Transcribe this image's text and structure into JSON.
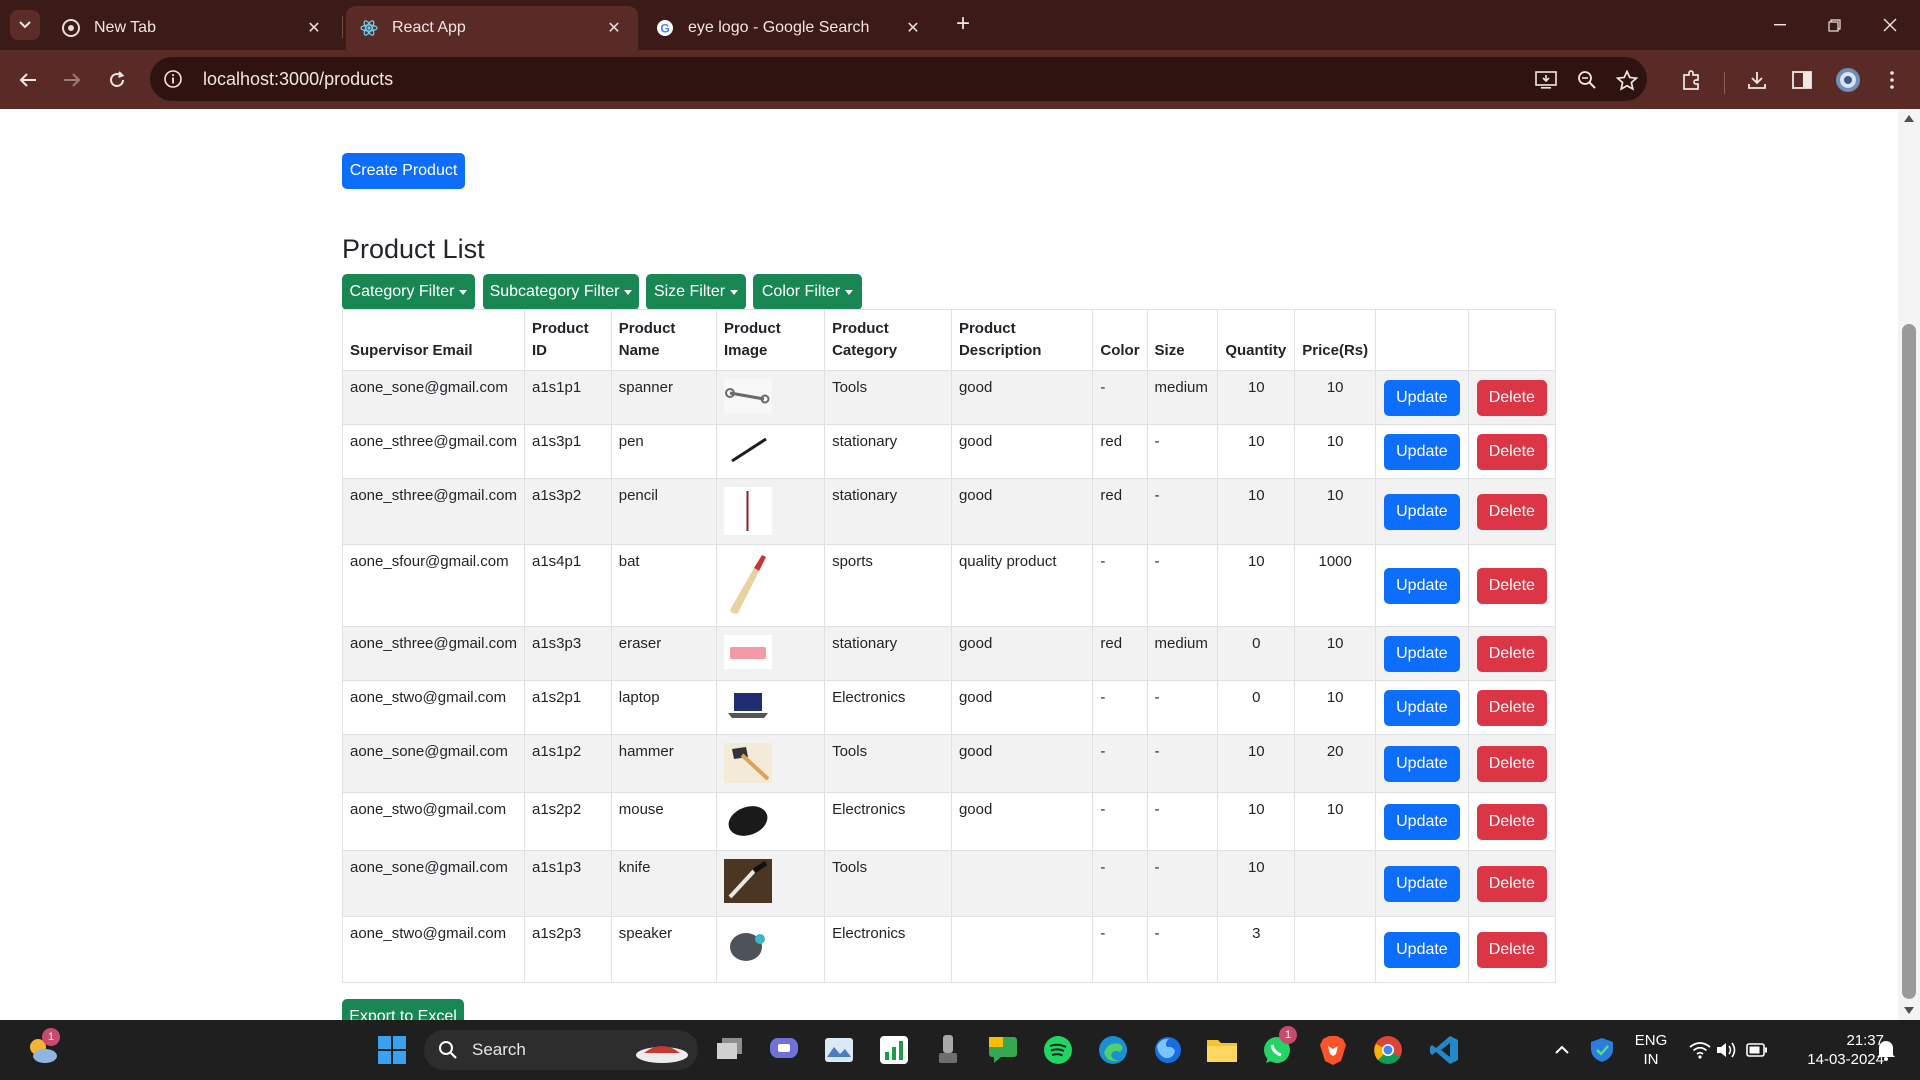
{
  "browser": {
    "tabs": [
      {
        "title": "New Tab",
        "icon": "chrome-icon"
      },
      {
        "title": "React App",
        "icon": "react-icon"
      },
      {
        "title": "eye logo - Google Search",
        "icon": "google-icon"
      }
    ],
    "url": "localhost:3000/products"
  },
  "page": {
    "create_button": "Create Product",
    "title": "Product List",
    "filters": {
      "category": "Category Filter",
      "subcategory": "Subcategory Filter",
      "size": "Size Filter",
      "color": "Color Filter"
    },
    "export_button": "Export to Excel"
  },
  "table": {
    "headers": [
      "Supervisor Email",
      "Product ID",
      "Product Name",
      "Product Image",
      "Product Category",
      "Product Description",
      "Color",
      "Size",
      "Quantity",
      "Price(Rs)"
    ],
    "update_label": "Update",
    "delete_label": "Delete",
    "rows": [
      {
        "email": "aone_sone@gmail.com",
        "id": "a1s1p1",
        "name": "spanner",
        "image": "spanner",
        "category": "Tools",
        "description": "good",
        "color": "-",
        "size": "medium",
        "quantity": "10",
        "price": "10"
      },
      {
        "email": "aone_sthree@gmail.com",
        "id": "a1s3p1",
        "name": "pen",
        "image": "pen",
        "category": "stationary",
        "description": "good",
        "color": "red",
        "size": "-",
        "quantity": "10",
        "price": "10"
      },
      {
        "email": "aone_sthree@gmail.com",
        "id": "a1s3p2",
        "name": "pencil",
        "image": "pencil",
        "category": "stationary",
        "description": "good",
        "color": "red",
        "size": "-",
        "quantity": "10",
        "price": "10"
      },
      {
        "email": "aone_sfour@gmail.com",
        "id": "a1s4p1",
        "name": "bat",
        "image": "bat",
        "category": "sports",
        "description": "quality product",
        "color": "-",
        "size": "-",
        "quantity": "10",
        "price": "1000"
      },
      {
        "email": "aone_sthree@gmail.com",
        "id": "a1s3p3",
        "name": "eraser",
        "image": "eraser",
        "category": "stationary",
        "description": "good",
        "color": "red",
        "size": "medium",
        "quantity": "0",
        "price": "10"
      },
      {
        "email": "aone_stwo@gmail.com",
        "id": "a1s2p1",
        "name": "laptop",
        "image": "laptop",
        "category": "Electronics",
        "description": "good",
        "color": "-",
        "size": "-",
        "quantity": "0",
        "price": "10"
      },
      {
        "email": "aone_sone@gmail.com",
        "id": "a1s1p2",
        "name": "hammer",
        "image": "hammer",
        "category": "Tools",
        "description": "good",
        "color": "-",
        "size": "-",
        "quantity": "10",
        "price": "20"
      },
      {
        "email": "aone_stwo@gmail.com",
        "id": "a1s2p2",
        "name": "mouse",
        "image": "mouse",
        "category": "Electronics",
        "description": "good",
        "color": "-",
        "size": "-",
        "quantity": "10",
        "price": "10"
      },
      {
        "email": "aone_sone@gmail.com",
        "id": "a1s1p3",
        "name": "knife",
        "image": "knife",
        "category": "Tools",
        "description": "",
        "color": "-",
        "size": "-",
        "quantity": "10",
        "price": ""
      },
      {
        "email": "aone_stwo@gmail.com",
        "id": "a1s2p3",
        "name": "speaker",
        "image": "speaker",
        "category": "Electronics",
        "description": "",
        "color": "-",
        "size": "-",
        "quantity": "3",
        "price": ""
      }
    ]
  },
  "taskbar": {
    "search_label": "Search",
    "weather_badge": "1",
    "whatsapp_badge": "1",
    "language": "ENG",
    "region": "IN",
    "time": "21:37",
    "date": "14-03-2024"
  },
  "colors": {
    "primary": "#0d6efd",
    "success": "#198754",
    "danger": "#dc3545",
    "chrome_frame": "#3b1a17"
  }
}
